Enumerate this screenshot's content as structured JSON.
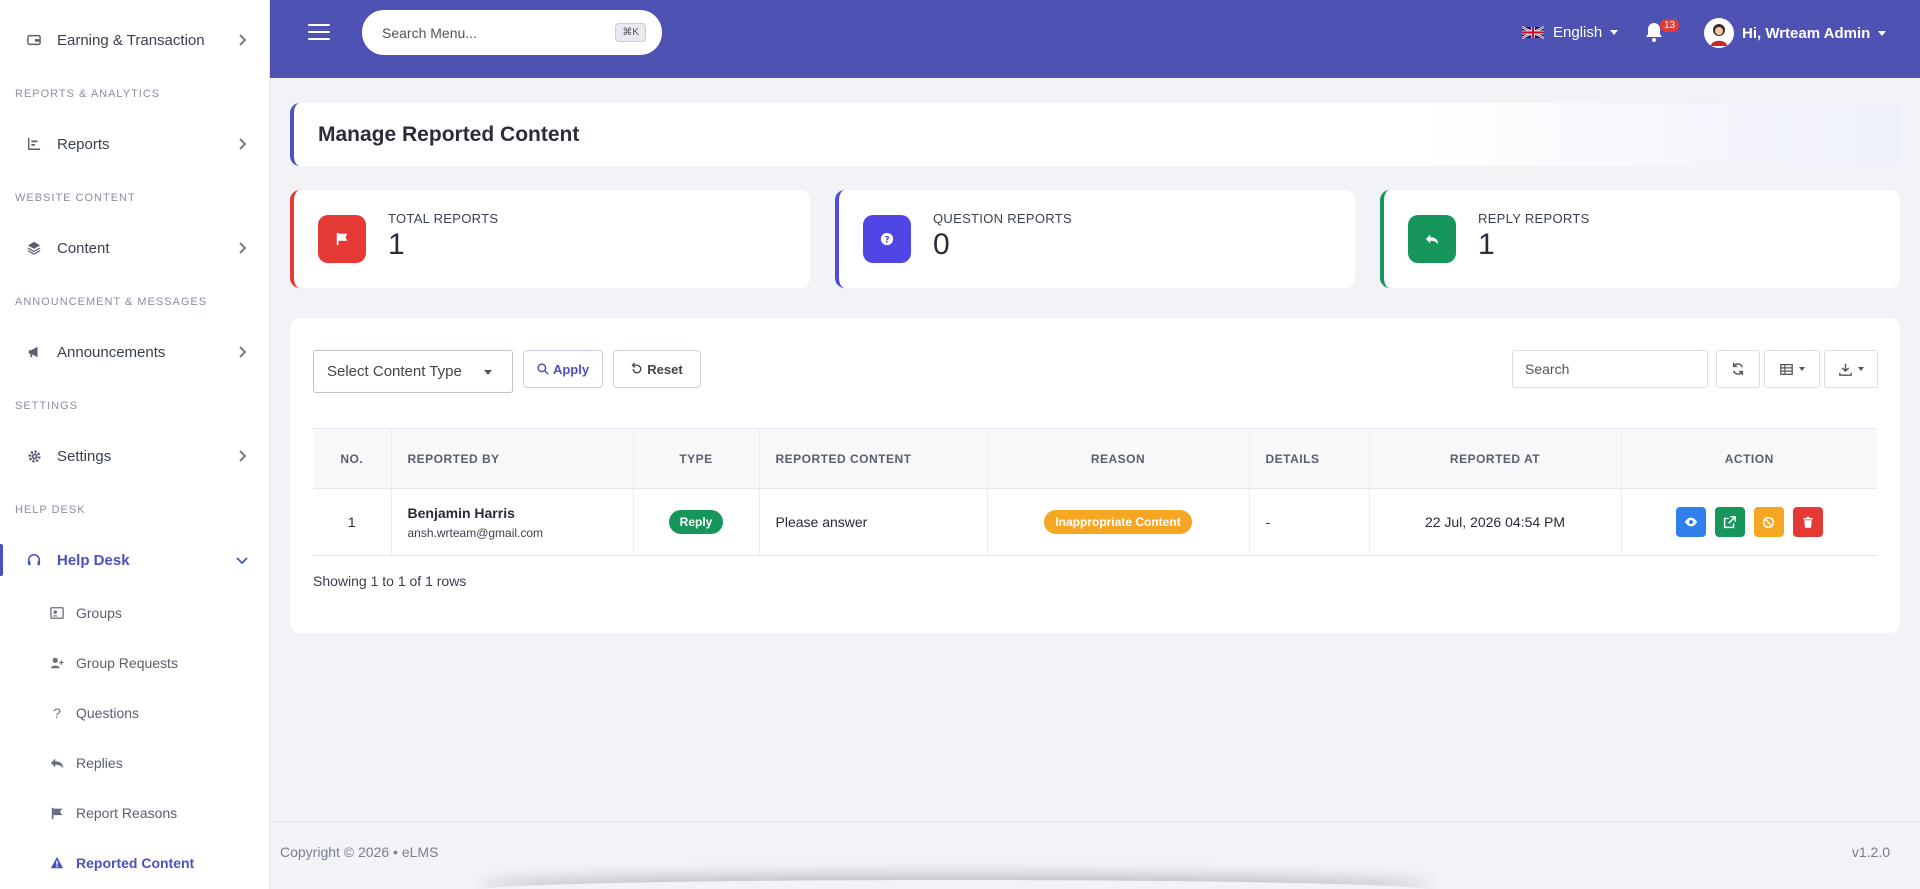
{
  "sidebar": {
    "items": [
      {
        "label": "Earning & Transaction",
        "icon": "wallet-icon"
      },
      {
        "label": "Reports",
        "icon": "bar-chart-icon"
      },
      {
        "label": "Content",
        "icon": "layers-icon"
      },
      {
        "label": "Announcements",
        "icon": "megaphone-icon"
      },
      {
        "label": "Settings",
        "icon": "gear-icon"
      },
      {
        "label": "Help Desk",
        "icon": "headset-icon"
      }
    ],
    "sections": [
      "Reports & Analytics",
      "Website Content",
      "Announcement & Messages",
      "Settings",
      "Help Desk"
    ],
    "help_desk_sub": [
      {
        "label": "Groups",
        "icon": "group-icon"
      },
      {
        "label": "Group Requests",
        "icon": "user-plus-icon"
      },
      {
        "label": "Questions",
        "icon": "question-icon"
      },
      {
        "label": "Replies",
        "icon": "reply-icon"
      },
      {
        "label": "Report Reasons",
        "icon": "flag-icon"
      },
      {
        "label": "Reported Content",
        "icon": "warning-icon"
      }
    ]
  },
  "header": {
    "search_placeholder": "Search Menu...",
    "shortcut": "⌘K",
    "language": "English",
    "notification_count": "13",
    "greeting": "Hi, Wrteam Admin"
  },
  "page": {
    "title": "Manage Reported Content"
  },
  "stats": [
    {
      "label": "TOTAL REPORTS",
      "value": "1",
      "color": "#e53935",
      "icon": "flag-icon"
    },
    {
      "label": "QUESTION REPORTS",
      "value": "0",
      "color": "#4f46e5",
      "icon": "question-icon"
    },
    {
      "label": "REPLY REPORTS",
      "value": "1",
      "color": "#16965a",
      "icon": "reply-icon"
    }
  ],
  "filters": {
    "content_type_placeholder": "Select Content Type",
    "apply_label": "Apply",
    "reset_label": "Reset",
    "search_placeholder": "Search"
  },
  "table": {
    "columns": [
      "No.",
      "Reported By",
      "Type",
      "Reported Content",
      "Reason",
      "Details",
      "Reported At",
      "Action"
    ],
    "rows": [
      {
        "no": "1",
        "name": "Benjamin Harris",
        "email": "ansh.wrteam@gmail.com",
        "type": "Reply",
        "content": "Please answer",
        "reason": "Inappropriate Content",
        "details": "-",
        "reported_at": "22 Jul, 2026 04:54 PM"
      }
    ],
    "showing": "Showing 1 to 1 of 1 rows"
  },
  "footer": {
    "copyright": "Copyright © 2026  •  eLMS",
    "version": "v1.2.0"
  },
  "colors": {
    "primary": "#4e52b3",
    "accent": "#4c51bf",
    "success": "#16965a",
    "warning": "#f5a623",
    "danger": "#e53935",
    "info": "#2f80ed"
  }
}
